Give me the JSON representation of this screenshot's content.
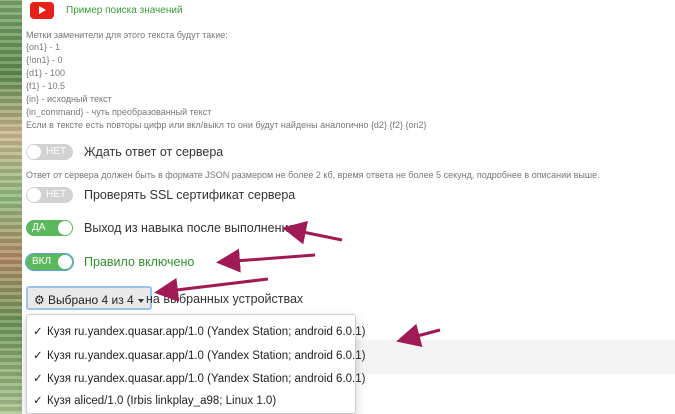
{
  "header": {
    "link_text": "Пример поиска значений"
  },
  "help": {
    "intro": "Метки заменители для этого текста будут такие:",
    "lines": [
      "{on1} - 1",
      "{!on1} - 0",
      "{d1} - 100",
      "{f1} - 10.5",
      "{in} - исходный текст",
      "{in_command} - чуть преобразованный текст",
      "Если в тексте есть повторы цифр или вкл/выкл то они будут найдены аналогично {d2} {f2} {on2}"
    ]
  },
  "options": [
    {
      "toggle": "НЕТ",
      "label": "Ждать ответ от сервера"
    },
    {
      "toggle": "НЕТ",
      "label": "Проверять SSL сертификат сервера"
    },
    {
      "toggle": "ДА",
      "label": "Выход из навыка после выполнения"
    },
    {
      "toggle": "ВКЛ",
      "label": "Правило включено"
    }
  ],
  "server_note": "Ответ от сервера должен быть в формате JSON размером не более 2 кб, время ответа не более 5 секунд, подробнее в описании выше.",
  "devices": {
    "button_label": "Выбрано 4 из 4",
    "trailing_text": "на выбранных устройствах",
    "items": [
      "Кузя ru.yandex.quasar.app/1.0 (Yandex Station; android 6.0.1)",
      "Кузя ru.yandex.quasar.app/1.0 (Yandex Station; android 6.0.1)",
      "Кузя ru.yandex.quasar.app/1.0 (Yandex Station; android 6.0.1)",
      "Кузя aliced/1.0 (Irbis linkplay_a98; Linux 1.0)"
    ]
  },
  "icons": {
    "video": "youtube-icon",
    "settings": "gears-icon",
    "selected": "checkmark-icon",
    "dropdown": "caret-down-icon"
  },
  "colors": {
    "on": "#5cb85c",
    "off": "#d2d2d2",
    "arrow": "#a01a55",
    "link": "#3c9a3c",
    "youtube": "#e62117"
  }
}
